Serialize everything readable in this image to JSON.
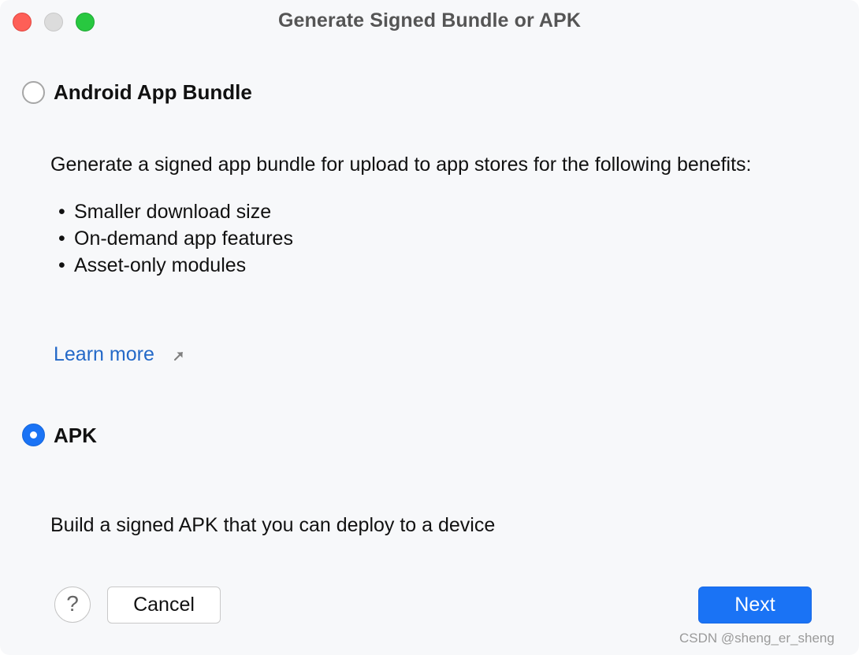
{
  "window": {
    "title": "Generate Signed Bundle or APK"
  },
  "options": {
    "bundle": {
      "label": "Android App Bundle",
      "selected": false,
      "description": "Generate a signed app bundle for upload to app stores for the following benefits:",
      "benefits": [
        "Smaller download size",
        "On-demand app features",
        "Asset-only modules"
      ],
      "learn_more": "Learn more"
    },
    "apk": {
      "label": "APK",
      "selected": true,
      "description": "Build a signed APK that you can deploy to a device"
    }
  },
  "footer": {
    "help": "?",
    "cancel": "Cancel",
    "next": "Next"
  },
  "watermark": "CSDN @sheng_er_sheng",
  "colors": {
    "accent": "#1a73f5",
    "link": "#2469c8",
    "close": "#fe5f57",
    "maximize": "#28c840"
  },
  "icons": {
    "learn_more_arrow": "external-link-arrow-icon",
    "help": "question-mark-icon"
  }
}
